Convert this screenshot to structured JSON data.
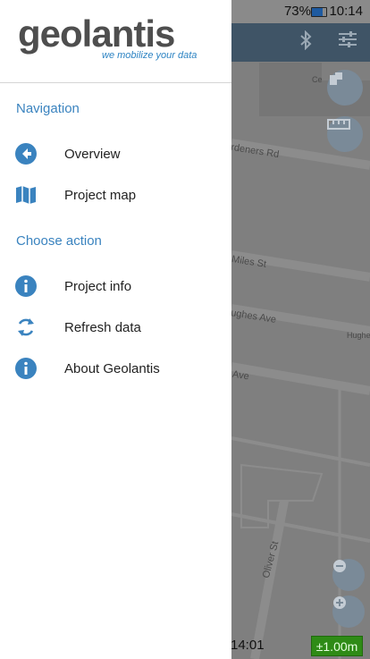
{
  "status_bar": {
    "battery_percent": "73%",
    "time": "10:14",
    "battery_level": 0.73
  },
  "drawer": {
    "logo_text": "geolantis",
    "tagline": "we mobilize your data",
    "sections": [
      {
        "header": "Navigation",
        "items": [
          {
            "label": "Overview",
            "icon": "arrow-left-circle-icon"
          },
          {
            "label": "Project map",
            "icon": "map-icon"
          }
        ]
      },
      {
        "header": "Choose action",
        "items": [
          {
            "label": "Project info",
            "icon": "info-icon"
          },
          {
            "label": "Refresh data",
            "icon": "refresh-icon"
          },
          {
            "label": "About Geolantis",
            "icon": "info-icon"
          }
        ]
      }
    ]
  },
  "map": {
    "streets": [
      "rdeners Rd",
      "Miles St",
      "ughes Ave",
      "Ave",
      "Oliver St",
      "Hughe",
      "Ce"
    ],
    "bottom_time": "14:01",
    "accuracy": "±1.00m"
  },
  "colors": {
    "accent": "#3a83bf",
    "topbar": "#3f5466",
    "accuracy_bg": "#2e8b16"
  }
}
